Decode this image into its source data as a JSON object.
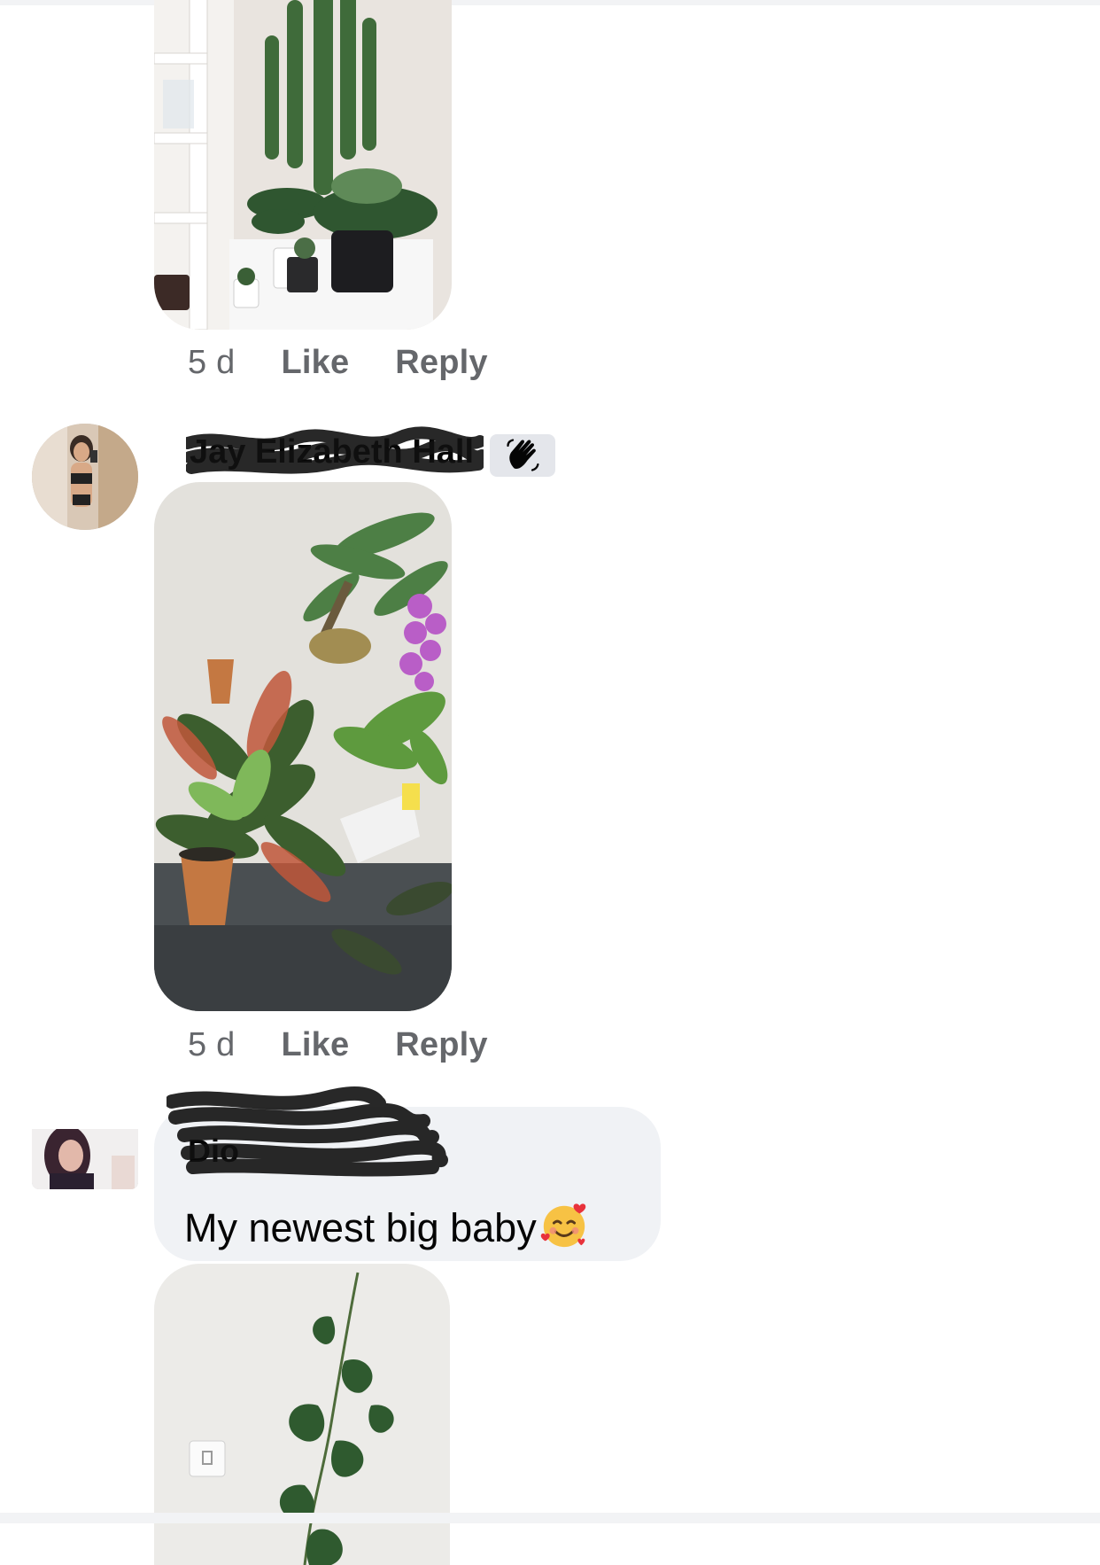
{
  "comments": [
    {
      "author": "",
      "image_alt": "plants-on-white-shelf-photo",
      "meta": {
        "time": "5 d",
        "like": "Like",
        "reply": "Reply"
      }
    },
    {
      "author": "Jay Elizabeth Hall",
      "badge_icon": "waving-hand-icon",
      "image_alt": "houseplants-with-orchid-photo",
      "meta": {
        "time": "5 d",
        "like": "Like",
        "reply": "Reply"
      }
    },
    {
      "author": "Dio",
      "text": "My newest big baby",
      "emoji": "smiling-face-with-hearts",
      "image_alt": "monstera-vine-photo"
    }
  ],
  "colors": {
    "meta_text": "#65676b",
    "bubble": "#f0f2f5",
    "badge": "#e4e6eb"
  }
}
